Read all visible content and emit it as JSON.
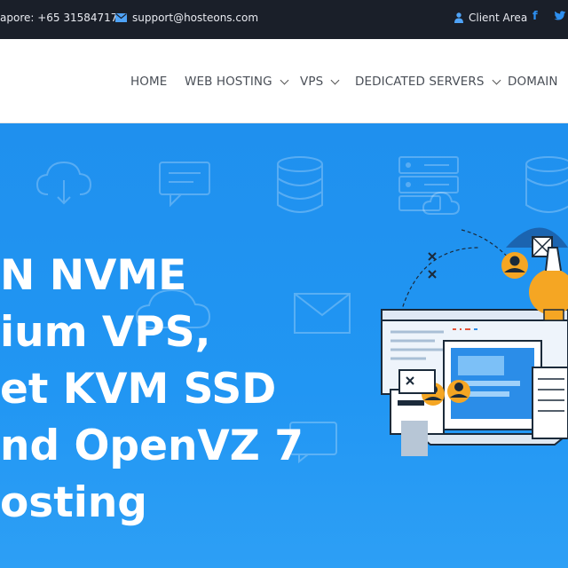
{
  "topbar": {
    "phone": "apore: +65 31584717",
    "email": "support@hosteons.com",
    "client_area": "Client Area"
  },
  "nav": {
    "items": [
      {
        "label": "HOME",
        "dropdown": false
      },
      {
        "label": "WEB HOSTING",
        "dropdown": true
      },
      {
        "label": "VPS",
        "dropdown": true
      },
      {
        "label": "DEDICATED SERVERS",
        "dropdown": true
      },
      {
        "label": "DOMAIN",
        "dropdown": false
      }
    ]
  },
  "hero": {
    "lines": [
      "N NVME",
      "ium VPS,",
      "et KVM SSD",
      "nd OpenVZ 7",
      "osting"
    ]
  },
  "colors": {
    "topbar_bg": "#1a1f29",
    "hero_bg": "#2196f3",
    "accent": "#2d8ff0",
    "orange": "#f5a623"
  },
  "icons": [
    "phone-icon",
    "mail-icon",
    "user-icon",
    "facebook-icon",
    "twitter-icon"
  ]
}
